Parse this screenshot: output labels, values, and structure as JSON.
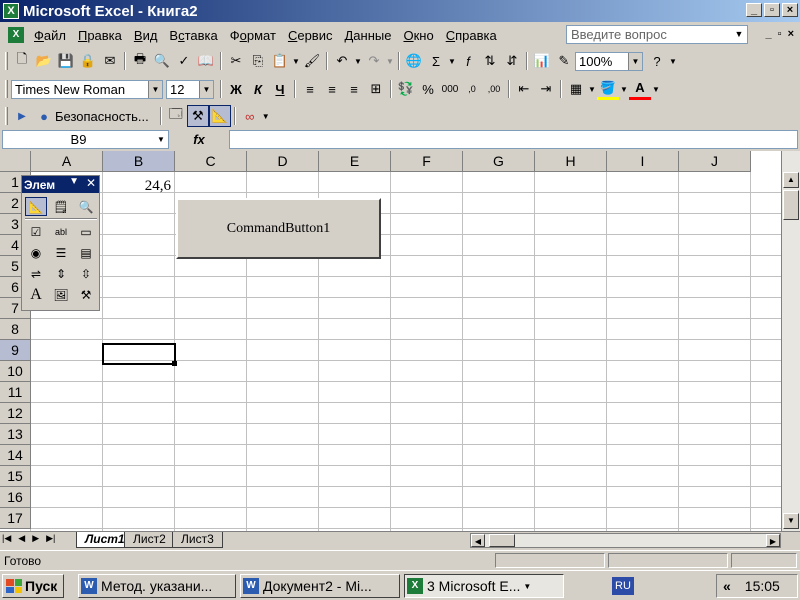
{
  "window": {
    "title": "Microsoft Excel - Книга2",
    "app_icon_letter": "X",
    "buttons": {
      "minimize": "_",
      "restore": "▫",
      "close": "×"
    }
  },
  "menu": {
    "items": [
      {
        "label": "Файл",
        "accel": "Ф"
      },
      {
        "label": "Правка",
        "accel": "П"
      },
      {
        "label": "Вид",
        "accel": "В"
      },
      {
        "label": "Вставка",
        "accel": "с"
      },
      {
        "label": "Формат",
        "accel": "о"
      },
      {
        "label": "Сервис",
        "accel": "С"
      },
      {
        "label": "Данные",
        "accel": "Д"
      },
      {
        "label": "Окно",
        "accel": "О"
      },
      {
        "label": "Справка",
        "accel": "С"
      }
    ],
    "help_placeholder": "Введите вопрос",
    "mdi_buttons": {
      "minimize": "_",
      "restore": "▫",
      "close": "×"
    }
  },
  "standard_toolbar": {
    "zoom": "100%"
  },
  "formatting_toolbar": {
    "font_name": "Times New Roman",
    "font_size": "12",
    "bold": "Ж",
    "italic": "К",
    "underline": "Ч"
  },
  "visual_basic_toolbar": {
    "security_label": "Безопасность..."
  },
  "formula_bar": {
    "name_box": "B9",
    "fx": "fx",
    "value": ""
  },
  "sheet": {
    "columns": [
      "A",
      "B",
      "C",
      "D",
      "E",
      "F",
      "G",
      "H",
      "I",
      "J"
    ],
    "rows": [
      "1",
      "2",
      "3",
      "4",
      "5",
      "6",
      "7",
      "8",
      "9",
      "10",
      "11",
      "12",
      "13",
      "14",
      "15",
      "16",
      "17"
    ],
    "selected_column": "B",
    "selected_row": "9",
    "cells": {
      "B1": "24,6"
    },
    "command_button_caption": "CommandButton1"
  },
  "toolbox": {
    "title": "Элем",
    "tools": [
      {
        "name": "design-mode-icon"
      },
      {
        "name": "properties-icon"
      },
      {
        "name": "view-code-icon"
      },
      {
        "name": "checkbox-icon"
      },
      {
        "name": "textbox-icon"
      },
      {
        "name": "command-button-icon"
      },
      {
        "name": "option-button-icon"
      },
      {
        "name": "listbox-icon"
      },
      {
        "name": "combobox-icon"
      },
      {
        "name": "toggle-button-icon"
      },
      {
        "name": "spin-button-icon"
      },
      {
        "name": "scrollbar-icon"
      },
      {
        "name": "label-icon"
      },
      {
        "name": "image-icon"
      },
      {
        "name": "more-controls-icon"
      }
    ]
  },
  "sheet_tabs": {
    "tabs": [
      "Лист1",
      "Лист2",
      "Лист3"
    ],
    "active": "Лист1"
  },
  "status_bar": {
    "text": "Готово"
  },
  "taskbar": {
    "start_label": "Пуск",
    "buttons": [
      {
        "label": "Метод. указани...",
        "icon": "word-icon"
      },
      {
        "label": "Документ2 - Mi...",
        "icon": "word-icon"
      },
      {
        "label": "3 Microsoft E...",
        "icon": "excel-icon"
      }
    ],
    "language": "RU",
    "tray_chevron": "«",
    "clock": "15:05"
  },
  "colors": {
    "title_bar": "#0a246a",
    "excel_green": "#1d7c3a",
    "word_blue": "#2c5cb0",
    "selection_header": "#b6bdd2"
  }
}
